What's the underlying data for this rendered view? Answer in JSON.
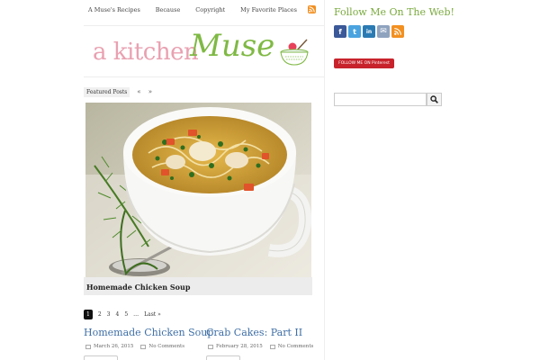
{
  "nav": {
    "items": [
      {
        "label": "A Muse's Recipes"
      },
      {
        "label": "Because"
      },
      {
        "label": "Copyright"
      },
      {
        "label": "My Favorite Places"
      }
    ]
  },
  "logo": {
    "part1": "a kitchen",
    "part2": "Muse"
  },
  "featured": {
    "label": "Featured Posts",
    "prev": "«",
    "next": "»",
    "caption": "Homemade Chicken Soup"
  },
  "pagination": {
    "pages": [
      "1",
      "2",
      "3",
      "4",
      "5",
      "…",
      "Last »"
    ],
    "current": "1"
  },
  "posts": [
    {
      "title": "Homemade Chicken Soup",
      "date": "March 26, 2015",
      "comments": "No Comments"
    },
    {
      "title": "Crab Cakes: Part II",
      "date": "February 28, 2015",
      "comments": "No Comments"
    }
  ],
  "sidebar": {
    "heading": "Follow Me On The Web!",
    "social_icons": [
      {
        "name": "facebook-icon",
        "glyph": "f",
        "color": "#3b5998"
      },
      {
        "name": "twitter-icon",
        "glyph": "t",
        "color": "#4aa3df"
      },
      {
        "name": "linkedin-icon",
        "glyph": "in",
        "color": "#2a7bb4"
      },
      {
        "name": "email-icon",
        "glyph": "✉",
        "color": "#8fa3bf"
      },
      {
        "name": "rss-icon",
        "glyph": "",
        "color": "#f29021"
      }
    ],
    "pinterest_label": "FOLLOW ME ON Pinterest",
    "search_placeholder": ""
  },
  "colors": {
    "link_blue": "#3f6fa6",
    "heading_green": "#7aaa3e",
    "logo_pink": "#e9a1b1",
    "logo_green": "#7fb944",
    "pinterest_red": "#c8232c"
  }
}
